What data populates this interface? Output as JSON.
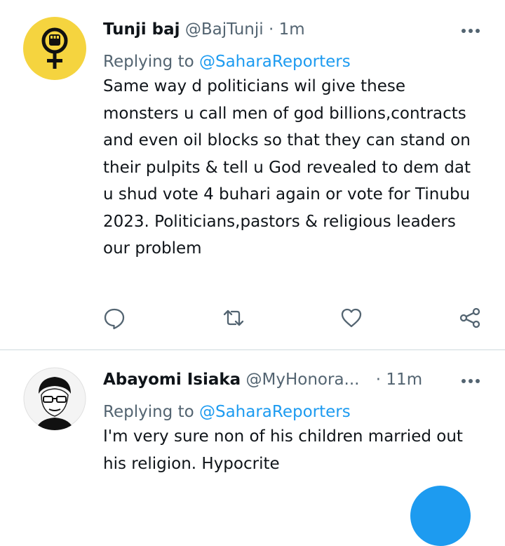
{
  "tweets": [
    {
      "name": "Tunji baj",
      "handle": "@BajTunji",
      "separator": "·",
      "time": "1m",
      "replying_prefix": "Replying to",
      "replying_to": "@SaharaReporters",
      "text": "Same way d politicians wil give these monsters u call men of god billions,contracts and even oil blocks so that they can stand on their pulpits & tell u God revealed to dem dat u shud vote 4 buhari again or vote for Tinubu 2023. Politicians,pastors & religious leaders our problem",
      "avatar_icon": "female-symbol-fist-icon"
    },
    {
      "name": "Abayomi Isiaka",
      "handle": "@MyHonora...",
      "separator": "·",
      "time": "11m",
      "replying_prefix": "Replying to",
      "replying_to": "@SaharaReporters",
      "text": "I'm very sure non of his children married out his religion. Hypocrite",
      "avatar_icon": "portrait-avatar"
    }
  ],
  "actions": [
    "reply-icon",
    "retweet-icon",
    "like-icon",
    "share-icon"
  ],
  "colors": {
    "accent": "#1d9bf0",
    "secondary_text": "#536471",
    "primary_text": "#0f1419",
    "avatar_yellow": "#f5d43f",
    "divider": "#cfd9de"
  }
}
